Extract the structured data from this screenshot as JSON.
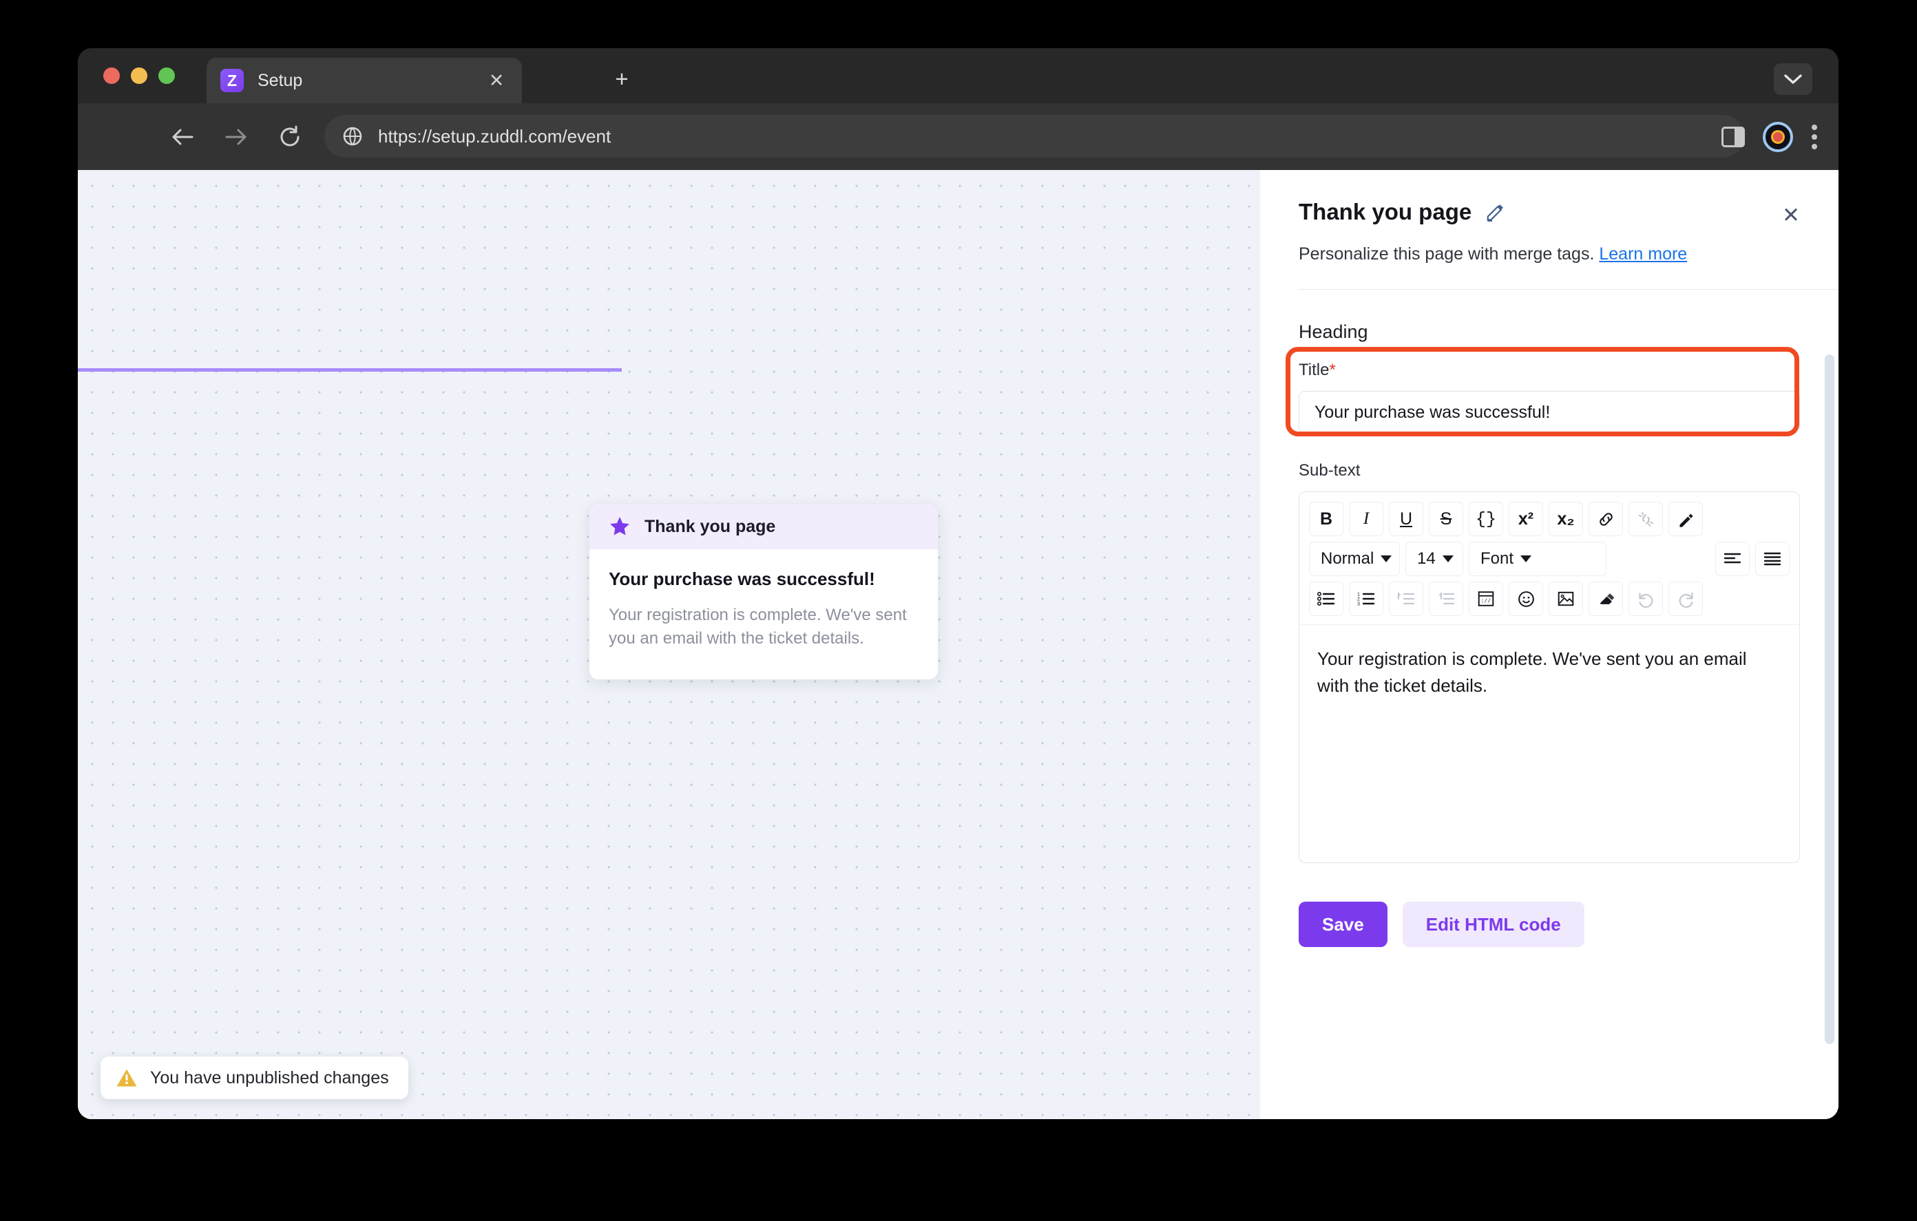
{
  "browser": {
    "tab": {
      "title": "Setup",
      "favicon_letter": "Z",
      "favicon_color": "#7c3aed",
      "close_glyph": "✕"
    },
    "new_tab_glyph": "+",
    "url": "https://setup.zuddl.com/event",
    "traffic_lights": [
      "#ed6a5e",
      "#f4bd4f",
      "#61c554"
    ]
  },
  "canvas": {
    "preview_card": {
      "header_label": "Thank you page",
      "title": "Your purchase was successful!",
      "subtext": "Your registration is complete. We've sent you an email with the ticket details."
    },
    "toast": {
      "text": "You have unpublished changes"
    }
  },
  "panel": {
    "title": "Thank you page",
    "subtitle_text": "Personalize this page with merge tags.",
    "subtitle_link": "Learn more",
    "close_glyph": "✕",
    "heading_section_label": "Heading",
    "title_field": {
      "label": "Title",
      "required_marker": "*",
      "value": "Your purchase was successful!",
      "annotation_color": "#f04a23"
    },
    "subtext_field": {
      "label": "Sub-text",
      "value": "Your registration is complete. We've sent you an email with the ticket details."
    },
    "editor_toolbar": {
      "row1": [
        {
          "name": "bold",
          "label": "B"
        },
        {
          "name": "italic",
          "label": "I"
        },
        {
          "name": "underline",
          "label": "U"
        },
        {
          "name": "strikethrough",
          "label": "S"
        },
        {
          "name": "merge-tags",
          "label": "{}"
        },
        {
          "name": "superscript",
          "label": "x²"
        },
        {
          "name": "subscript",
          "label": "x₂"
        },
        {
          "name": "link",
          "label": "🔗"
        },
        {
          "name": "unlink",
          "label": "🔗",
          "disabled": true
        },
        {
          "name": "text-color-pen",
          "label": "✒"
        }
      ],
      "row2": {
        "style": "Normal",
        "size": "14",
        "font": "Font",
        "align_left": "align-left",
        "align_justify": "align-justify"
      },
      "row3": [
        {
          "name": "bullet-list",
          "label": "☰"
        },
        {
          "name": "numbered-list",
          "label": "☰"
        },
        {
          "name": "indent",
          "label": "⇥",
          "disabled": true
        },
        {
          "name": "outdent",
          "label": "⇤",
          "disabled": true
        },
        {
          "name": "embed-iframe",
          "label": "://"
        },
        {
          "name": "emoji",
          "label": "☺"
        },
        {
          "name": "insert-image",
          "label": "Ὓc"
        },
        {
          "name": "clear-format-eraser",
          "label": "◢"
        },
        {
          "name": "undo",
          "label": "↺",
          "disabled": true
        },
        {
          "name": "redo",
          "label": "↻",
          "disabled": true
        }
      ]
    },
    "buttons": {
      "save": "Save",
      "edit_html": "Edit HTML code",
      "save_color": "#7c3aed",
      "ghost_bg": "#f0e9fd"
    }
  }
}
